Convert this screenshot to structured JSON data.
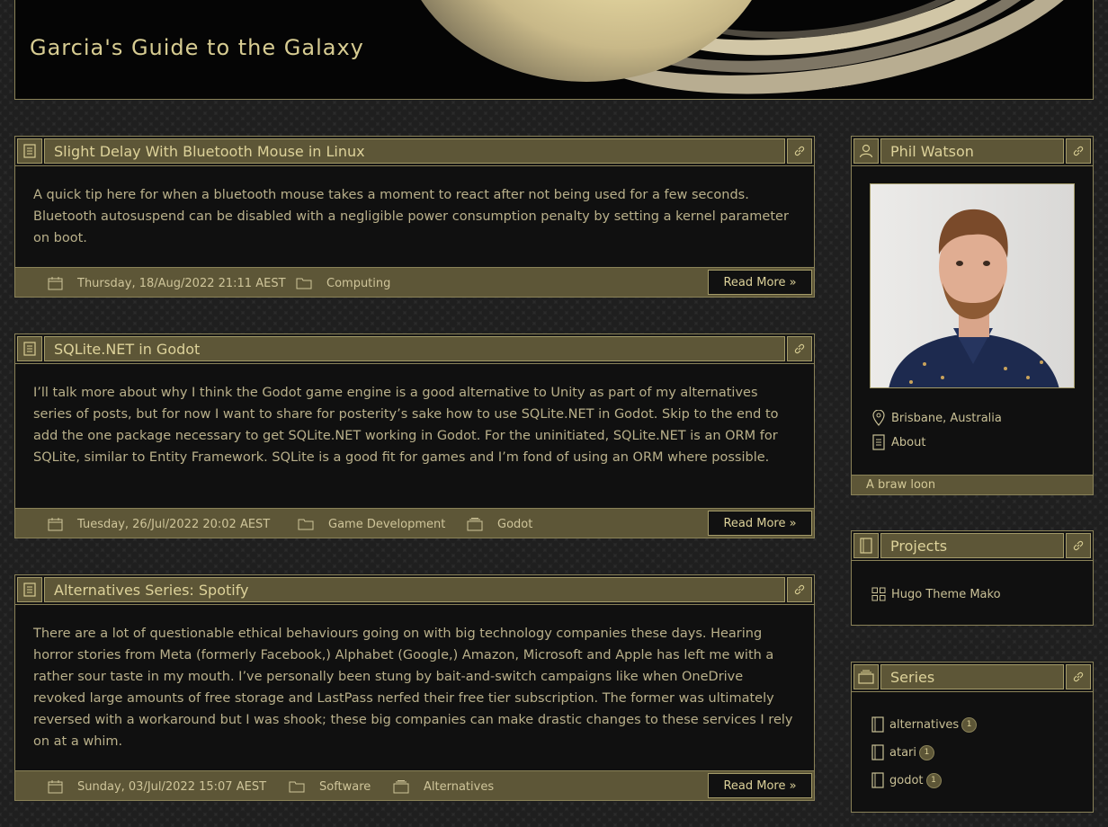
{
  "site": {
    "title": "Garcia's Guide to the Galaxy"
  },
  "posts": [
    {
      "title": "Slight Delay With Bluetooth Mouse in Linux",
      "summary": "A quick tip here for when a bluetooth mouse takes a moment to react after not being used for a few seconds. Bluetooth autosuspend can be disabled with a negligible power consumption penalty by setting a kernel parameter on boot.",
      "date": "Thursday, 18/Aug/2022 21:11 AEST",
      "category": "Computing",
      "read_more": "Read More »"
    },
    {
      "title": "SQLite.NET in Godot",
      "summary": "I’ll talk more about why I think the Godot game engine is a good alternative to Unity as part of my alternatives series of posts, but for now I want to share for posterity’s sake how to use SQLite.NET in Godot. Skip to the end to add the one package necessary to get SQLite.NET working in Godot. For the uninitiated, SQLite.NET is an ORM for SQLite, similar to Entity Framework. SQLite is a good fit for games and I’m fond of using an ORM where possible.",
      "date": "Tuesday, 26/Jul/2022 20:02 AEST",
      "category": "Game Development",
      "series": "Godot",
      "read_more": "Read More »"
    },
    {
      "title": "Alternatives Series: Spotify",
      "summary": "There are a lot of questionable ethical behaviours going on with big technology companies these days. Hearing horror stories from Meta (formerly Facebook,) Alphabet (Google,) Amazon, Microsoft and Apple has left me with a rather sour taste in my mouth. I’ve personally been stung by bait-and-switch campaigns like when OneDrive revoked large amounts of free storage and LastPass nerfed their free tier subscription. The former was ultimately reversed with a workaround but I was shook; these big companies can make drastic changes to these services I rely on at a whim.",
      "date": "Sunday, 03/Jul/2022 15:07 AEST",
      "category": "Software",
      "series": "Alternatives",
      "read_more": "Read More »"
    }
  ],
  "profile": {
    "name": "Phil Watson",
    "location": "Brisbane, Australia",
    "about": "About",
    "tagline": "A braw loon"
  },
  "projects": {
    "title": "Projects",
    "items": [
      {
        "label": "Hugo Theme Mako"
      }
    ]
  },
  "series": {
    "title": "Series",
    "items": [
      {
        "label": "alternatives",
        "count": "1"
      },
      {
        "label": "atari",
        "count": "1"
      },
      {
        "label": "godot",
        "count": "1"
      }
    ]
  },
  "colors": {
    "accent": "#5d5637",
    "border": "#8a8258",
    "text": "#c8bf8f",
    "panel_bg": "#101010"
  }
}
